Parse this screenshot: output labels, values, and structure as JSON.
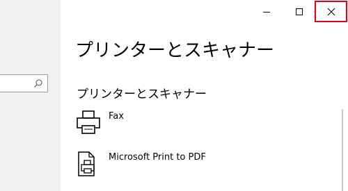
{
  "window": {
    "close_accent": "#e60012"
  },
  "sidebar": {
    "search": {
      "value": "",
      "icon": "search-icon"
    }
  },
  "titlebar": {
    "buttons": [
      {
        "name": "minimize",
        "icon": "minimize-icon"
      },
      {
        "name": "maximize",
        "icon": "maximize-icon"
      },
      {
        "name": "close",
        "icon": "close-icon"
      }
    ]
  },
  "main": {
    "title": "プリンターとスキャナー",
    "section_heading": "プリンターとスキャナー",
    "devices": [
      {
        "label": "Fax",
        "icon": "fax-printer-icon"
      },
      {
        "label": "Microsoft Print to PDF",
        "icon": "pdf-printer-icon"
      }
    ]
  }
}
